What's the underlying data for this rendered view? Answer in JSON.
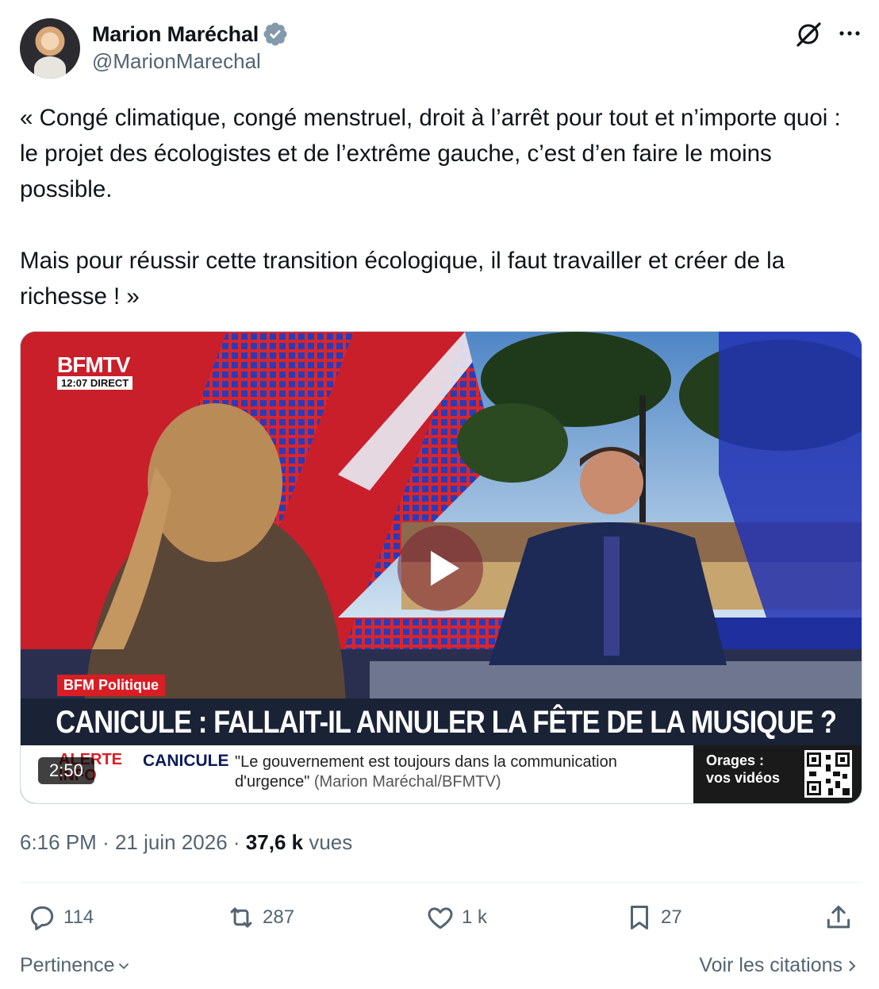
{
  "author": {
    "display_name": "Marion Maréchal",
    "handle": "@MarionMarechal",
    "verified_icon": "verified-badge-icon"
  },
  "tweet": {
    "text": "« Congé climatique, congé menstruel, droit à l’arrêt pour tout et n’importe quoi : le projet des écologistes et de l’extrême gauche, c’est d’en faire le moins possible.\n\nMais pour réussir cette transition écologique, il faut travailler et créer de la richesse ! »"
  },
  "video": {
    "channel": "BFMTV",
    "broadcast_time": "12:07 DIRECT",
    "show_tag": "BFM Politique",
    "headline": "CANICULE : FALLAIT-IL ANNULER LA FÊTE DE LA MUSIQUE ?",
    "ticker_alert": "ALERTE INFO",
    "ticker_topic": "CANICULE",
    "ticker_quote": "\"Le gouvernement est toujours dans la communication d'urgence\"",
    "ticker_source": "(Marion Maréchal/BFMTV)",
    "promo": "Orages : vos vidéos",
    "duration": "2:50"
  },
  "meta": {
    "time": "6:16 PM",
    "separator": "·",
    "date": "21 juin 2026",
    "views_count": "37,6 k",
    "views_label": "vues"
  },
  "actions": {
    "replies": "114",
    "reposts": "287",
    "likes": "1 k",
    "bookmarks": "27"
  },
  "footer": {
    "sort_label": "Pertinence",
    "quotes_link": "Voir les citations"
  },
  "colors": {
    "text_primary": "#0f1419",
    "text_secondary": "#536471",
    "verified": "#829aab"
  }
}
